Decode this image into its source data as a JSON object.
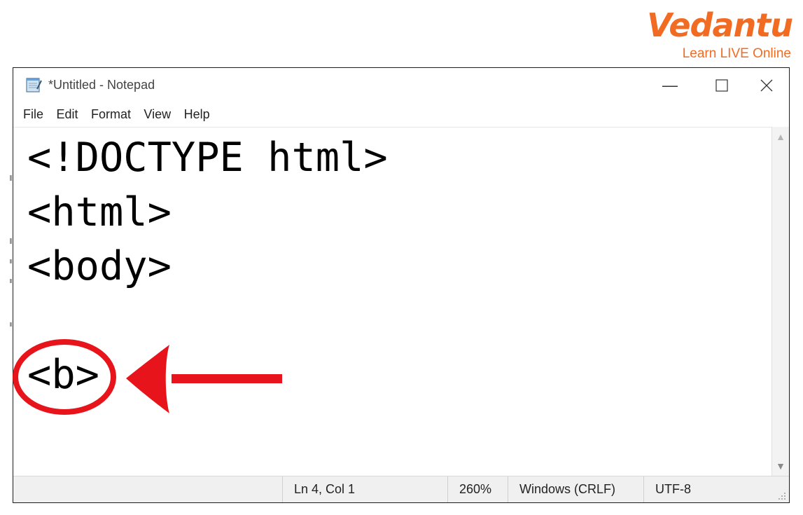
{
  "logo": {
    "wordmark": "Vedantu",
    "tagline": "Learn LIVE Online",
    "color": "#f26b23"
  },
  "window": {
    "title": "*Untitled - Notepad",
    "icon": "notepad-icon",
    "controls": [
      "minimize-icon",
      "maximize-icon",
      "close-icon"
    ]
  },
  "menu": {
    "items": [
      {
        "label": "File"
      },
      {
        "label": "Edit"
      },
      {
        "label": "Format"
      },
      {
        "label": "View"
      },
      {
        "label": "Help"
      }
    ]
  },
  "editor": {
    "lines": [
      "<!DOCTYPE html>",
      "<html>",
      "<body>",
      "",
      "<b>"
    ]
  },
  "status": {
    "position": "Ln 4, Col 1",
    "zoom": "260%",
    "line_ending": "Windows (CRLF)",
    "encoding": "UTF-8"
  },
  "annotation": {
    "color": "#e8141b",
    "highlight": "circle-around-b-tag",
    "pointer": "arrow-left"
  }
}
